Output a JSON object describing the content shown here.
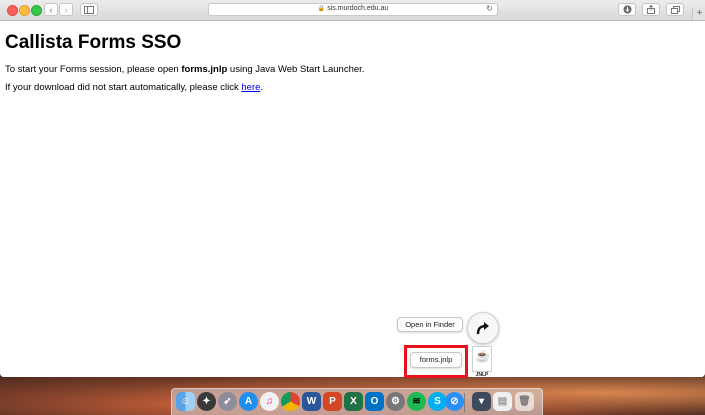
{
  "browser": {
    "address": "sis.murdoch.edu.au"
  },
  "page": {
    "title": "Callista Forms SSO",
    "line1_prefix": "To start your Forms session, please open ",
    "line1_file": "forms.jnlp",
    "line1_suffix": " using Java Web Start Launcher.",
    "line2_prefix": "If your download did not start automatically, please click ",
    "line2_link": "here",
    "line2_suffix": "."
  },
  "download_popover": {
    "open_in_finder": "Open in Finder",
    "file_name": "forms.jnlp",
    "file_type_label": "JNLP",
    "highlight_color": "#e8121b"
  },
  "dock": {
    "apps": [
      "finder-icon",
      "launchpad-icon",
      "rocket-icon",
      "app-store-icon",
      "itunes-icon",
      "chrome-icon",
      "word-icon",
      "powerpoint-icon",
      "excel-icon",
      "outlook-icon",
      "system-preferences-icon",
      "spotify-icon",
      "skype-icon",
      "safari-icon",
      "downloads-stack-icon",
      "documents-icon",
      "trash-icon"
    ],
    "letters": {
      "word": "W",
      "powerpoint": "P",
      "excel": "X",
      "outlook": "O",
      "skype": "S"
    }
  }
}
